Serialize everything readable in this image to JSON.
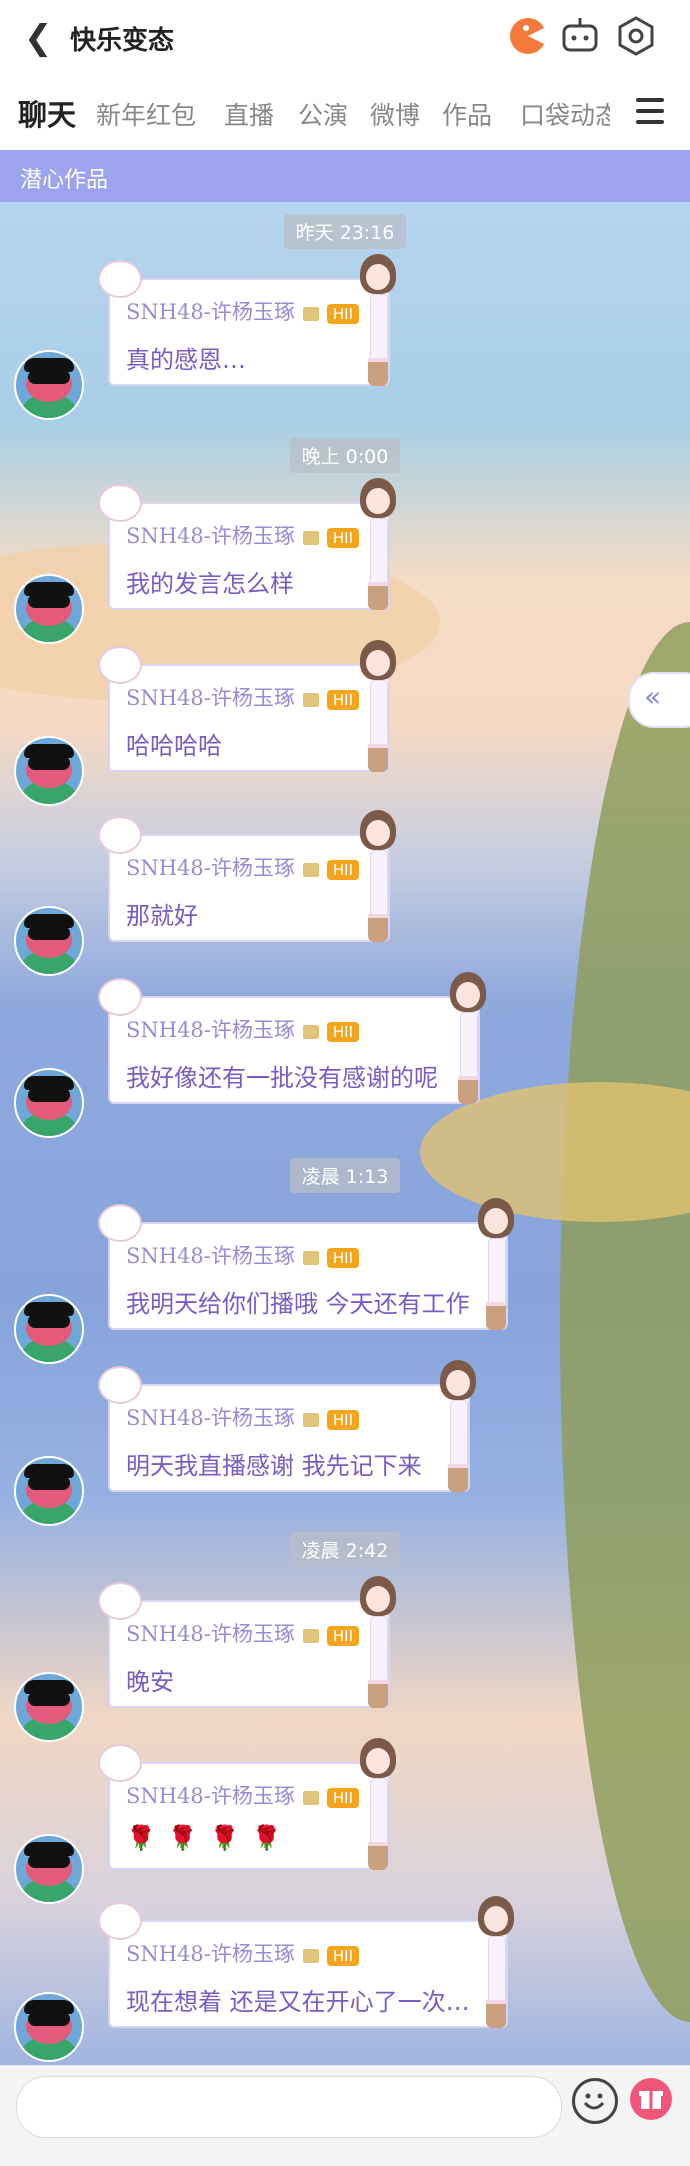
{
  "header": {
    "back_icon": "chevron-left-icon",
    "title": "快乐变态"
  },
  "tabs": [
    "聊天",
    "新年红包",
    "直播",
    "公演",
    "微博",
    "作品",
    "口袋动态"
  ],
  "section": {
    "label": "潜心作品"
  },
  "side_button": {
    "icon": "double-chevron-left-icon"
  },
  "timestamps": [
    "昨天 23:16",
    "晚上 0:00",
    "凌晨 1:13",
    "凌晨 2:42"
  ],
  "messages": [
    {
      "nick": "SNH48-许杨玉琢",
      "badge": "HII",
      "text": "真的感恩…"
    },
    {
      "nick": "SNH48-许杨玉琢",
      "badge": "HII",
      "text": "我的发言怎么样"
    },
    {
      "nick": "SNH48-许杨玉琢",
      "badge": "HII",
      "text": "哈哈哈哈"
    },
    {
      "nick": "SNH48-许杨玉琢",
      "badge": "HII",
      "text": "那就好"
    },
    {
      "nick": "SNH48-许杨玉琢",
      "badge": "HII",
      "text": "我好像还有一批没有感谢的呢"
    },
    {
      "nick": "SNH48-许杨玉琢",
      "badge": "HII",
      "text": "我明天给你们播哦 今天还有工作"
    },
    {
      "nick": "SNH48-许杨玉琢",
      "badge": "HII",
      "text": "明天我直播感谢 我先记下来"
    },
    {
      "nick": "SNH48-许杨玉琢",
      "badge": "HII",
      "text": "晚安"
    },
    {
      "nick": "SNH48-许杨玉琢",
      "badge": "HII",
      "text": "🌹🌹🌹🌹"
    },
    {
      "nick": "SNH48-许杨玉琢",
      "badge": "HII",
      "text": "现在想着 还是又在开心了一次…"
    }
  ],
  "footer": {
    "input_placeholder": "",
    "emoji_icon": "emoji-icon",
    "gift_icon": "gift-icon"
  }
}
